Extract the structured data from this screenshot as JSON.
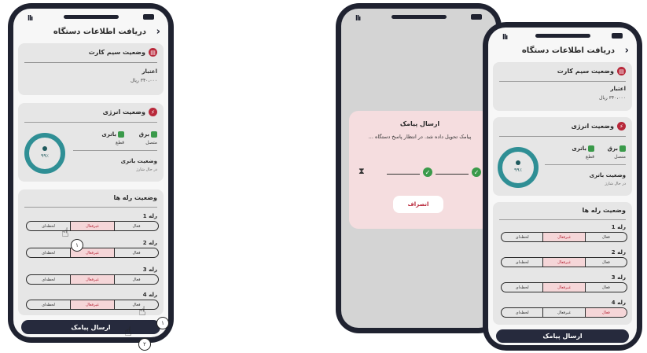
{
  "status": {
    "signal": "llı"
  },
  "header": {
    "title": "دریافت اطلاعات دستگاه",
    "back": "‹"
  },
  "sim": {
    "title": "وضعیت سیم کارت",
    "credit_label": "اعتبار",
    "credit_value": "۳۴۰،۰۰۰ ریال"
  },
  "energy": {
    "title": "وضعیت انرژی",
    "power_label": "برق",
    "power_status": "متصل",
    "battery_label": "باتری",
    "battery_status": "قطع",
    "battery_state_title": "وضعیت باتری",
    "battery_state": "در حال شارژ",
    "percent": "۹۹٪"
  },
  "relays": {
    "title": "وضعیت رله ها",
    "options": [
      "فعال",
      "غیرفعال",
      "لحظه‌ای"
    ],
    "items": [
      {
        "label": "رله 1"
      },
      {
        "label": "رله 2"
      },
      {
        "label": "رله 3"
      },
      {
        "label": "رله 4"
      }
    ]
  },
  "send_button": "ارسال پیامک",
  "modal": {
    "title": "ارسال پیامک",
    "message": "پیامک تحویل داده شد. در انتظار پاسخ دستگاه ...",
    "cancel": "انصراف"
  },
  "steps": {
    "one": "۱",
    "two": "۲"
  },
  "icons": {
    "check": "✓",
    "hourglass": "⧗",
    "hand": "☝",
    "sim": "▤",
    "energy": "⚡"
  },
  "colors": {
    "accent": "#b8283a",
    "dark": "#262a3d",
    "teal": "#2f8f95",
    "green": "#3a9a4a",
    "selected_bg": "#f5d6d8"
  }
}
